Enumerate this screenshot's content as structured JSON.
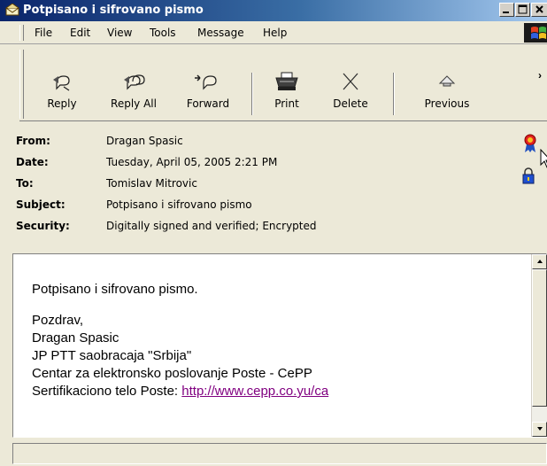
{
  "window": {
    "title": "Potpisano i sifrovano pismo"
  },
  "menu": {
    "items": [
      "File",
      "Edit",
      "View",
      "Tools",
      "Message",
      "Help"
    ]
  },
  "toolbar": {
    "buttons": [
      {
        "label": "Reply",
        "icon": "reply-icon"
      },
      {
        "label": "Reply All",
        "icon": "reply-all-icon"
      },
      {
        "label": "Forward",
        "icon": "forward-icon"
      },
      {
        "label": "Print",
        "icon": "print-icon"
      },
      {
        "label": "Delete",
        "icon": "delete-icon"
      },
      {
        "label": "Previous",
        "icon": "previous-icon"
      }
    ]
  },
  "header": {
    "fields": [
      {
        "label": "From:",
        "value": "Dragan Spasic"
      },
      {
        "label": "Date:",
        "value": "Tuesday, April 05, 2005 2:21 PM"
      },
      {
        "label": "To:",
        "value": "Tomislav Mitrovic"
      },
      {
        "label": "Subject:",
        "value": "Potpisano i sifrovano pismo"
      },
      {
        "label": "Security:",
        "value": "Digitally signed and verified;  Encrypted"
      }
    ],
    "icons": [
      "digital-signature-ribbon-icon",
      "encryption-lock-icon"
    ]
  },
  "body": {
    "lines": [
      "Potpisano i sifrovano pismo.",
      "Pozdrav,",
      "Dragan Spasic",
      "JP PTT saobracaja \"Srbija\"",
      "Centar za elektronsko poslovanje Poste - CePP"
    ],
    "last_line_prefix": "Sertifikaciono telo Poste: ",
    "link": "http://www.cepp.co.yu/ca"
  },
  "colors": {
    "title_gradient_start": "#0a246a",
    "title_gradient_end": "#a6caf0",
    "chrome": "#ece9d8",
    "link": "#800080"
  }
}
